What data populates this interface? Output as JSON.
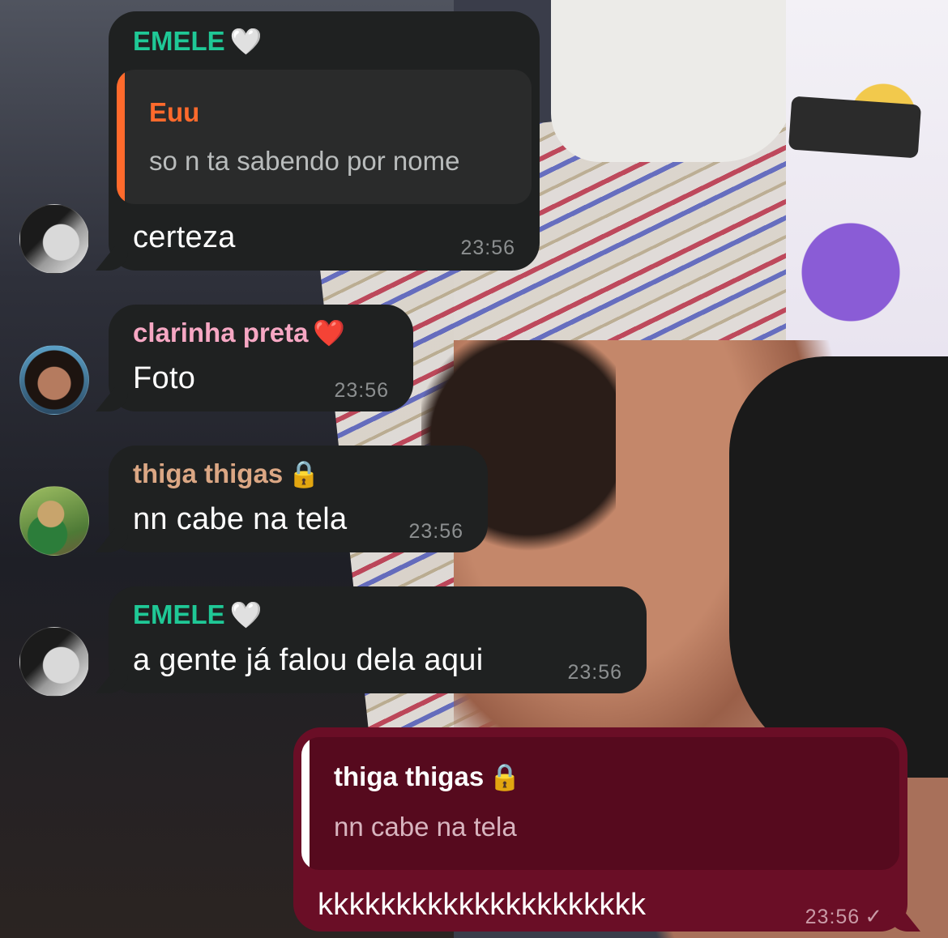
{
  "colors": {
    "incoming_bubble": "#1f2121",
    "outgoing_bubble": "#6a0e26",
    "name_emele": "#1fc896",
    "name_euu": "#ff6a2c",
    "name_clarinha": "#f6a7c3",
    "name_thiga": "#dba784",
    "time_text": "#8c8f90"
  },
  "messages": [
    {
      "sender": "EMELE",
      "sender_emoji": "🤍",
      "reply_to": {
        "name": "Euu",
        "text": "so n ta sabendo por nome"
      },
      "text": "certeza",
      "time": "23:56",
      "avatar": "avatar-emele"
    },
    {
      "sender": "clarinha preta",
      "sender_emoji": "❤️",
      "text": "Foto",
      "time": "23:56",
      "avatar": "avatar-clarinha"
    },
    {
      "sender": "thiga thigas",
      "sender_emoji": "🔒",
      "text": "nn cabe na tela",
      "time": "23:56",
      "avatar": "avatar-thiga"
    },
    {
      "sender": "EMELE",
      "sender_emoji": "🤍",
      "text": "a gente já falou dela aqui",
      "time": "23:56",
      "avatar": "avatar-emele"
    }
  ],
  "outgoing": {
    "reply_to": {
      "name": "thiga thigas",
      "name_emoji": "🔒",
      "text": "nn cabe na tela"
    },
    "text": "kkkkkkkkkkkkkkkkkkkkk",
    "time": "23:56",
    "status_icon": "single-check-icon"
  }
}
